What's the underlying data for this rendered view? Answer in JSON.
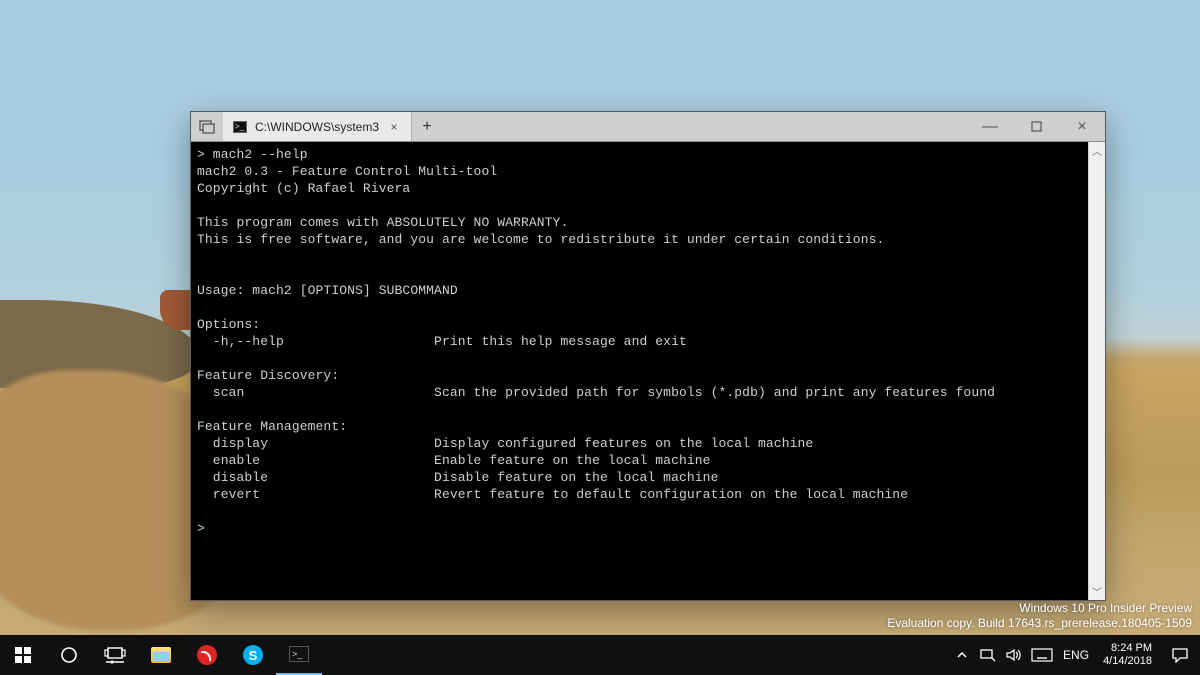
{
  "window": {
    "tab_title": "C:\\WINDOWS\\system3",
    "tab_close_glyph": "×",
    "new_tab_glyph": "+",
    "min_glyph": "—",
    "close_glyph": "×"
  },
  "terminal": {
    "lines": "> mach2 --help\nmach2 0.3 - Feature Control Multi-tool\nCopyright (c) Rafael Rivera\n\nThis program comes with ABSOLUTELY NO WARRANTY.\nThis is free software, and you are welcome to redistribute it under certain conditions.\n\n\nUsage: mach2 [OPTIONS] SUBCOMMAND\n\nOptions:\n  -h,--help                   Print this help message and exit\n\nFeature Discovery:\n  scan                        Scan the provided path for symbols (*.pdb) and print any features found\n\nFeature Management:\n  display                     Display configured features on the local machine\n  enable                      Enable feature on the local machine\n  disable                     Disable feature on the local machine\n  revert                      Revert feature to default configuration on the local machine\n\n>"
  },
  "watermark": {
    "line1": "Windows 10 Pro Insider Preview",
    "line2": "Evaluation copy. Build 17643.rs_prerelease.180405-1509"
  },
  "tray": {
    "lang": "ENG",
    "time": "8:24 PM",
    "date": "4/14/2018"
  }
}
